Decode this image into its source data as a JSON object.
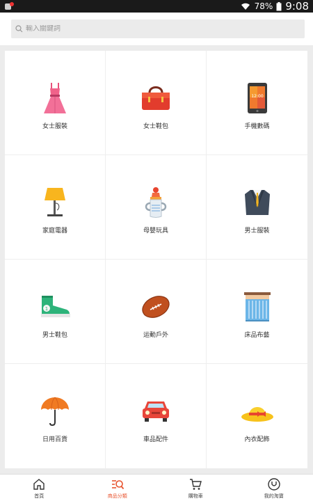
{
  "status_bar": {
    "battery": "78%",
    "time": "9:08"
  },
  "search": {
    "placeholder": "輸入關鍵詞"
  },
  "categories": [
    {
      "label": "女士服裝",
      "icon": "dress-icon"
    },
    {
      "label": "女士鞋包",
      "icon": "handbag-icon"
    },
    {
      "label": "手機數碼",
      "icon": "smartphone-icon"
    },
    {
      "label": "家庭電器",
      "icon": "lamp-icon"
    },
    {
      "label": "母嬰玩具",
      "icon": "baby-bottle-icon"
    },
    {
      "label": "男士服裝",
      "icon": "suit-icon"
    },
    {
      "label": "男士鞋包",
      "icon": "sneaker-icon"
    },
    {
      "label": "运動戶外",
      "icon": "football-icon"
    },
    {
      "label": "床品布藝",
      "icon": "curtain-icon"
    },
    {
      "label": "日用百貨",
      "icon": "umbrella-icon"
    },
    {
      "label": "車品配件",
      "icon": "car-icon"
    },
    {
      "label": "內衣配飾",
      "icon": "sun-hat-icon"
    }
  ],
  "tabs": [
    {
      "label": "首頁",
      "icon": "home-icon"
    },
    {
      "label": "商品分類",
      "icon": "category-search-icon",
      "active": true
    },
    {
      "label": "購物車",
      "icon": "cart-icon"
    },
    {
      "label": "我的淘寶",
      "icon": "profile-icon"
    }
  ],
  "colors": {
    "accent": "#e8542f"
  }
}
